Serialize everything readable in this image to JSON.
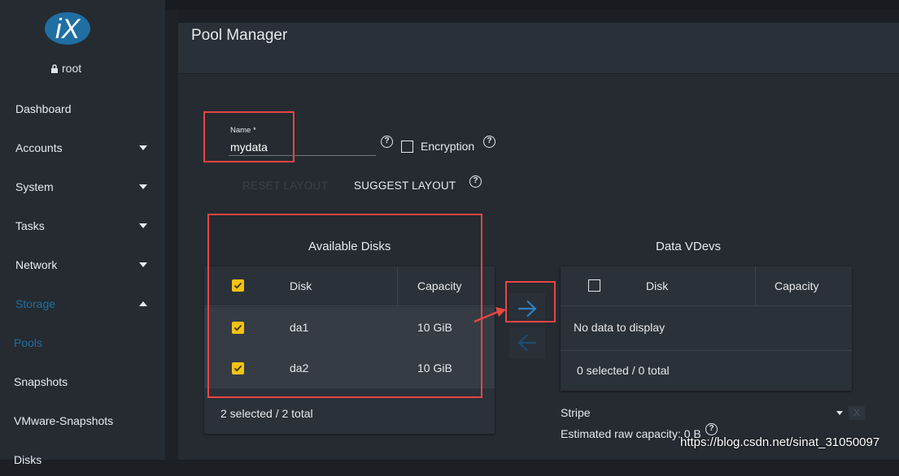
{
  "sidebar": {
    "logo_text": "iX",
    "user": "root",
    "items": [
      {
        "label": "Dashboard",
        "caret": "none"
      },
      {
        "label": "Accounts",
        "caret": "down"
      },
      {
        "label": "System",
        "caret": "down"
      },
      {
        "label": "Tasks",
        "caret": "down"
      },
      {
        "label": "Network",
        "caret": "down"
      },
      {
        "label": "Storage",
        "caret": "up"
      },
      {
        "label": "Pools",
        "caret": "none"
      },
      {
        "label": "Snapshots",
        "caret": "none"
      },
      {
        "label": "VMware-Snapshots",
        "caret": "none"
      },
      {
        "label": "Disks",
        "caret": "none"
      }
    ],
    "active_color": "#1f6fa3"
  },
  "page": {
    "title": "Pool Manager"
  },
  "form": {
    "name_label": "Name *",
    "name_value": "mydata",
    "encryption_label": "Encryption",
    "reset_label": "RESET LAYOUT",
    "suggest_label": "SUGGEST LAYOUT"
  },
  "available": {
    "title": "Available Disks",
    "col_disk": "Disk",
    "col_capacity": "Capacity",
    "rows": [
      {
        "disk": "da1",
        "capacity": "10 GiB"
      },
      {
        "disk": "da2",
        "capacity": "10 GiB"
      }
    ],
    "footer": "2 selected / 2 total"
  },
  "vdevs": {
    "title": "Data VDevs",
    "col_disk": "Disk",
    "col_capacity": "Capacity",
    "empty": "No data to display",
    "footer": "0 selected / 0 total",
    "layout": "Stripe",
    "remove_label": "X",
    "estimate": "Estimated raw capacity: 0 B"
  },
  "watermark": "https://blog.csdn.net/sinat_31050097",
  "colors": {
    "accent": "#1f6fa3",
    "checkbox": "#f3c313",
    "highlight": "#e84545"
  }
}
